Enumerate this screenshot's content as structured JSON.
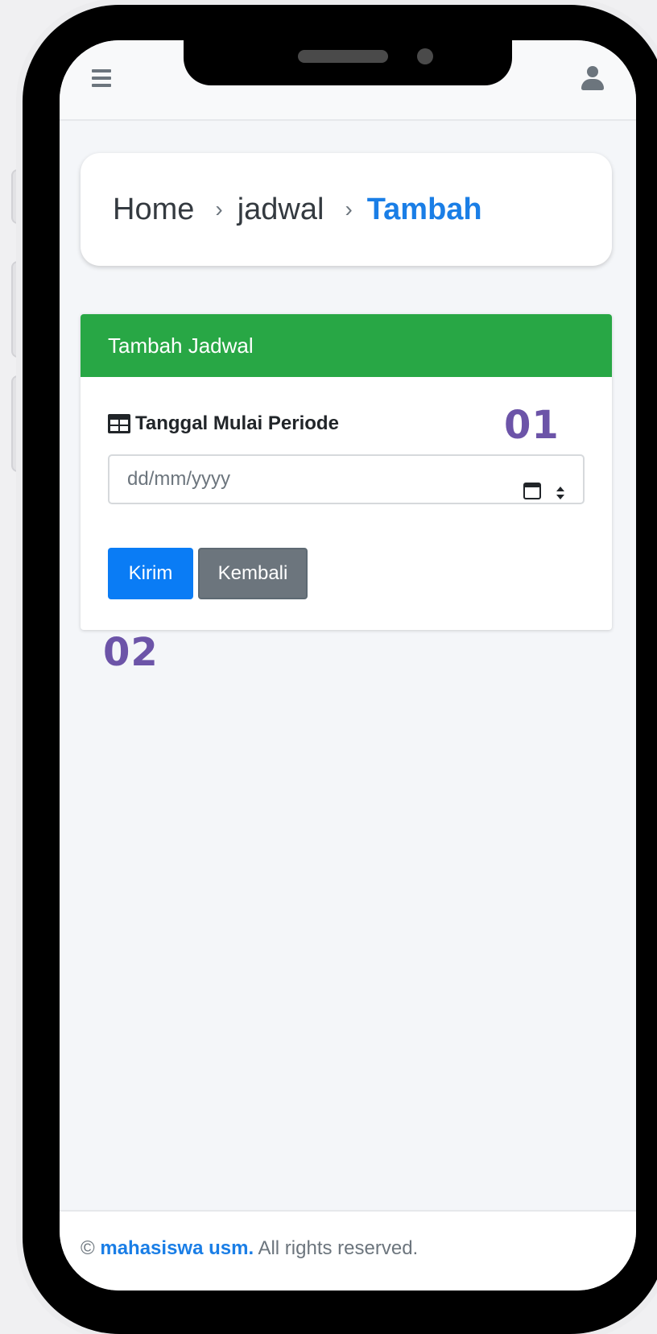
{
  "breadcrumb": {
    "home": "Home",
    "middle": "jadwal",
    "active": "Tambah",
    "separator": "›"
  },
  "form": {
    "header": "Tambah Jadwal",
    "field_label": "Tanggal Mulai Periode",
    "date_placeholder": "dd/mm/yyyy",
    "submit_label": "Kirim",
    "back_label": "Kembali"
  },
  "annotations": {
    "step1": "01",
    "step2": "02"
  },
  "footer": {
    "copyright": "©",
    "brand": "mahasiswa usm.",
    "rights": "All rights reserved."
  },
  "colors": {
    "header_green": "#28a745",
    "primary_blue": "#0a7cf5",
    "secondary_gray": "#6c757d",
    "link_blue": "#1a7ee6",
    "annotation_purple": "#6c54a8"
  },
  "icons": {
    "menu": "hamburger-menu-icon",
    "user": "user-icon",
    "field": "table-icon",
    "calendar": "calendar-icon",
    "spinner": "spinner-arrows-icon"
  }
}
